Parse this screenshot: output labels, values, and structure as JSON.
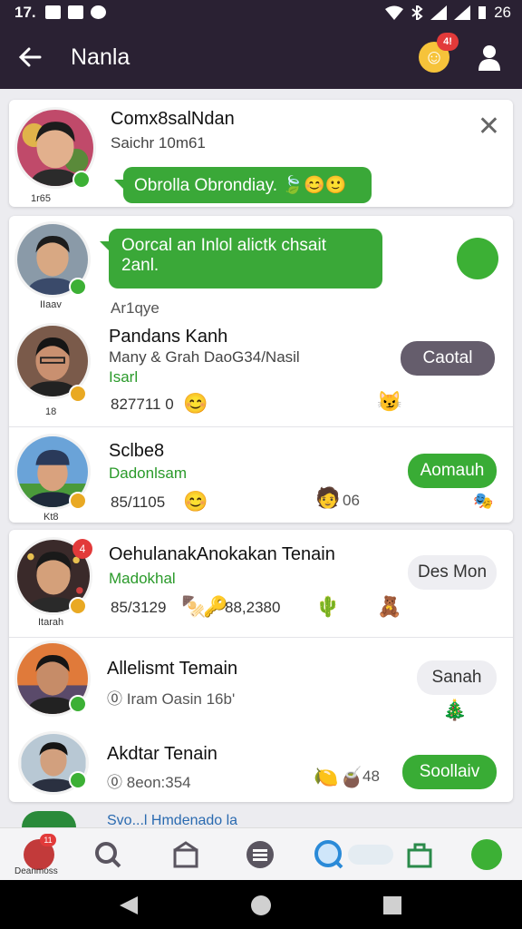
{
  "status_bar": {
    "time": "17.",
    "right_text": "26"
  },
  "app_bar": {
    "title": "Nanla",
    "badge": "4!"
  },
  "card1": {
    "name": "Comx8salNdan",
    "sub": "Saichr 10m61",
    "caption": "1r65",
    "bubble": "Obrolla Obrondiay."
  },
  "card2": {
    "bubble_line1": "Oorcal an Inlol alictk chsait",
    "bubble_line2": "2anl.",
    "caption": "IIaav",
    "label": "Ar1qye",
    "items": [
      {
        "name": "Pandans Kanh",
        "sub1": "Many & Grah DaoG34/Nasil",
        "sub2": "Isarl",
        "meta": "827711 0",
        "caption": "18",
        "pill": "Caotal"
      },
      {
        "name": "Sclbe8",
        "sub1": "Dadonlsam",
        "meta": "85/1105",
        "meta2": "06",
        "caption": "Kt8",
        "pill": "Aomauh"
      }
    ]
  },
  "card3": {
    "items": [
      {
        "name": "OehulanakAnokakan Tenain",
        "sub": "Madokhal",
        "meta": "85/3129",
        "meta2": "88,2380",
        "caption": "Itarah",
        "pill": "Des Mon",
        "badge": "4"
      },
      {
        "name": "Allelismt Temain",
        "meta": "Iram Oasin 16b'",
        "pill": "Sanah"
      },
      {
        "name": "Akdtar Tenain",
        "meta": "8eon:354",
        "meta2": "48",
        "pill": "Soollaiv"
      }
    ]
  },
  "bottom_nav": {
    "home_label": "Deanmoss",
    "badge": "11"
  },
  "footer_peek": "Svo...l Hmdenado la",
  "colors": {
    "bar": "#2a2133",
    "accent": "#39ac35",
    "bg": "#ececf0"
  }
}
